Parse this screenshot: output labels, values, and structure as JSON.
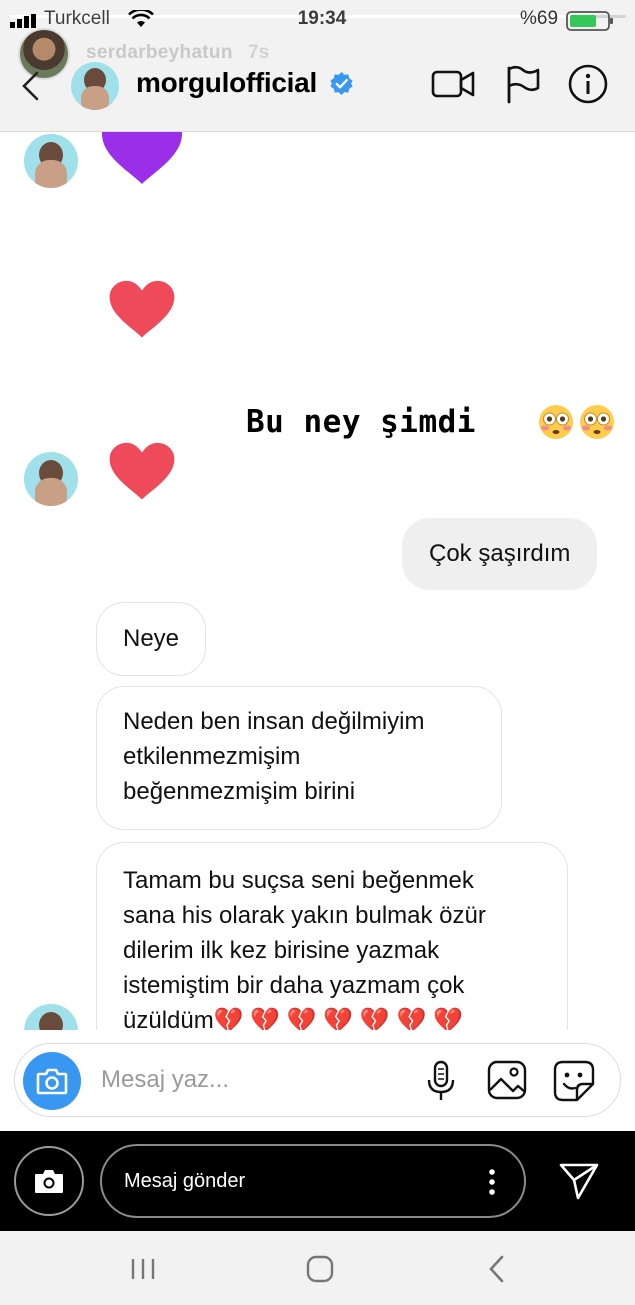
{
  "status_bar": {
    "carrier": "Turkcell",
    "time": "19:34",
    "battery": "%69"
  },
  "story": {
    "username": "serdarbeyhatun",
    "age": "7s",
    "progress": 0.92,
    "caption": "Bu ney şimdi",
    "caption_emoji": "flushed-face",
    "reply_placeholder": "Mesaj gönder"
  },
  "chat_header": {
    "name": "morgulofficial",
    "verified": true,
    "actions": [
      "video-call-icon",
      "flag-icon",
      "info-icon"
    ]
  },
  "thread": {
    "messages": [
      {
        "type": "heart",
        "from": "them",
        "color": "#9b2ee8"
      },
      {
        "type": "heart",
        "from": "them",
        "color": "#ef4a5a"
      },
      {
        "type": "heart",
        "from": "them",
        "color": "#ef4a5a"
      },
      {
        "type": "text",
        "from": "me",
        "lines": [
          "Çok şaşırdım"
        ]
      },
      {
        "type": "text",
        "from": "them",
        "lines": [
          "Neye"
        ]
      },
      {
        "type": "text",
        "from": "them",
        "lines": [
          "Neden ben insan değilmiyim",
          "etkilenmezmişim",
          "beğenmezmişim birini"
        ]
      },
      {
        "type": "text",
        "from": "them",
        "lines": [
          "Tamam bu suçsa seni beğenmek",
          "sana his olarak yakın bulmak özür",
          "dilerim ilk kez birisine yazmak",
          "istemiştim bir daha yazmam çok",
          "üzüldüm💔 💔 💔 💔 💔 💔 💔"
        ]
      }
    ]
  },
  "composer": {
    "placeholder": "Mesaj yaz..."
  },
  "colors": {
    "accent": "#3897f0",
    "verified": "#3897f0",
    "heart_red": "#ef4a5a",
    "heart_purple": "#9b2ee8",
    "sent_bubble": "#efefef"
  }
}
